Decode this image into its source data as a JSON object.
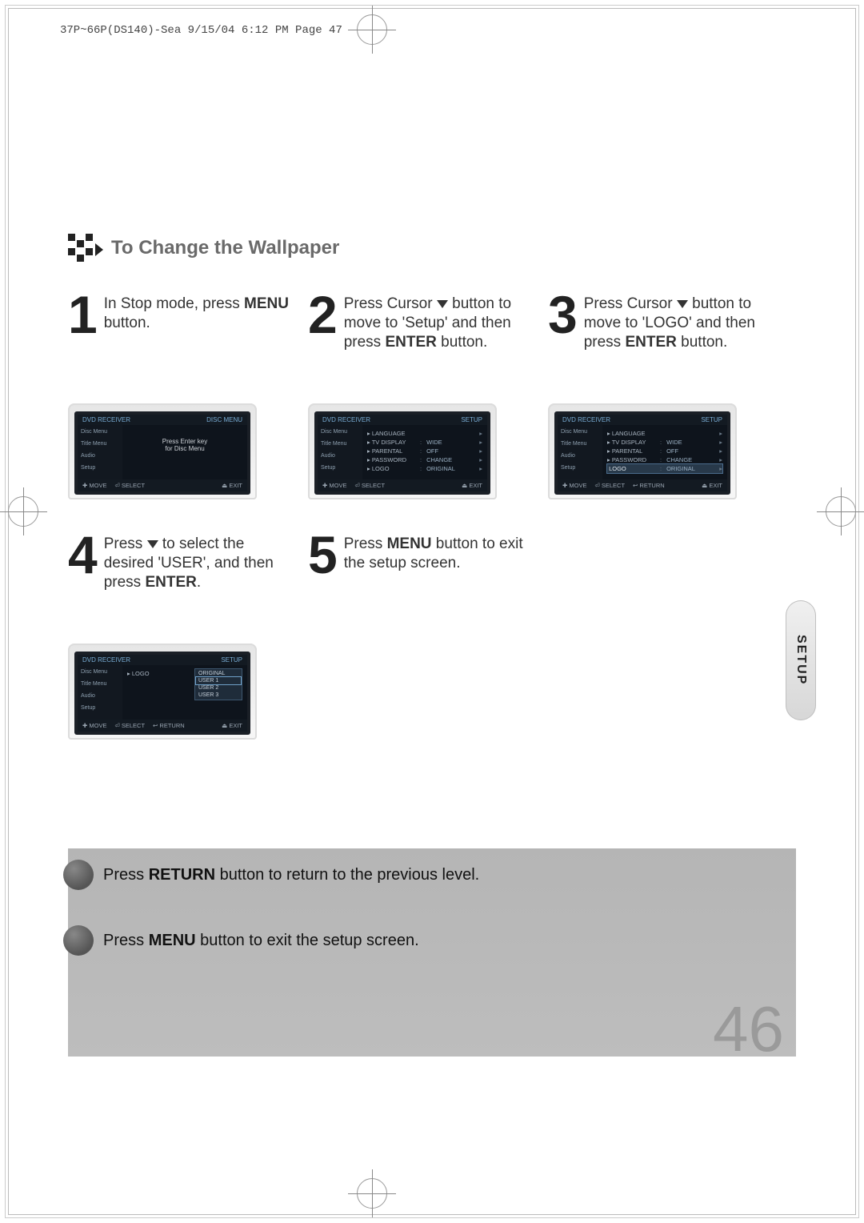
{
  "header": "37P~66P(DS140)-Sea  9/15/04 6:12 PM  Page 47",
  "title": "To Change the Wallpaper",
  "side_tab": "SETUP",
  "page_number": "46",
  "steps": {
    "s1": {
      "num": "1",
      "text_pre": "In Stop mode, press ",
      "text_b": "MENU",
      "text_post": " button."
    },
    "s2": {
      "num": "2",
      "text_a": "Press Cursor ",
      "text_b1": " button to move to 'Setup' and then press ",
      "text_bold": "ENTER",
      "text_c": " button."
    },
    "s3": {
      "num": "3",
      "text_a": "Press Cursor ",
      "text_b1": " button to move to 'LOGO' and then press ",
      "text_bold": "ENTER",
      "text_c": " button."
    },
    "s4": {
      "num": "4",
      "text_a": "Press ",
      "text_b1": " to select the desired 'USER', and then press ",
      "text_bold": "ENTER",
      "text_c": "."
    },
    "s5": {
      "num": "5",
      "text_a": "Press ",
      "text_bold": "MENU",
      "text_c": " button to exit the setup screen."
    }
  },
  "notes": {
    "n1_pre": "Press ",
    "n1_b": "RETURN",
    "n1_post": " button to return to the previous level.",
    "n2_pre": "Press ",
    "n2_b": "MENU",
    "n2_post": " button to exit the setup screen."
  },
  "tv": {
    "brand": "DVD RECEIVER",
    "disc_menu": "DISC MENU",
    "setup": "SETUP",
    "sidebar": {
      "a": "Disc Menu",
      "b": "Title Menu",
      "c": "Audio",
      "d": "Setup"
    },
    "s1_main_a": "Press Enter key",
    "s1_main_b": "for Disc Menu",
    "menu": {
      "lang": {
        "k": "LANGUAGE",
        "v": ""
      },
      "tv": {
        "k": "TV DISPLAY",
        "v": "WIDE"
      },
      "par": {
        "k": "PARENTAL",
        "v": "OFF"
      },
      "pass": {
        "k": "PASSWORD",
        "v": "CHANGE"
      },
      "logo": {
        "k": "LOGO",
        "v": "ORIGINAL"
      }
    },
    "logo_popup": {
      "a": "ORIGINAL",
      "b": "USER 1",
      "c": "USER 2",
      "d": "USER 3"
    },
    "foot": {
      "move": "MOVE",
      "select": "SELECT",
      "ret": "RETURN",
      "exit": "EXIT"
    }
  }
}
